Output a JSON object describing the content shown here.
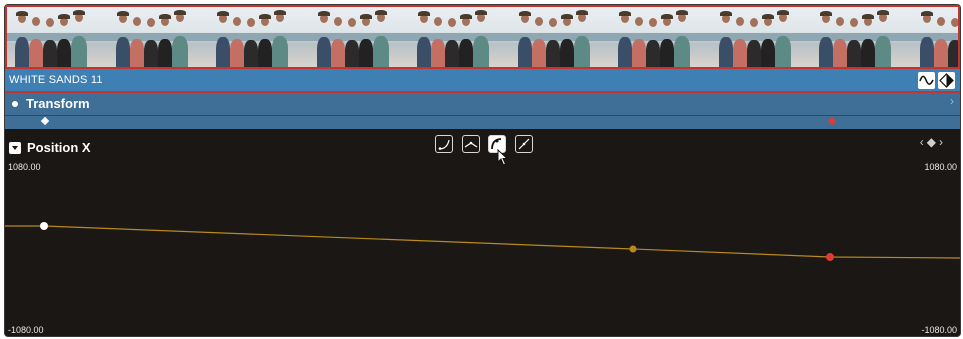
{
  "clip": {
    "name": "WHITE SANDS 11"
  },
  "transform": {
    "label": "Transform"
  },
  "parameter": {
    "label": "Position X"
  },
  "axis": {
    "top_left": "1080.00",
    "top_right": "1080.00",
    "bottom_left": "-1080.00",
    "bottom_right": "-1080.00"
  },
  "colors": {
    "clip_blue": "#3e7fb4",
    "selection_red": "#c3342f",
    "curve": "#b88a1c",
    "keyframe_selected": "#e03a36",
    "background": "#1b1714"
  },
  "icons": {
    "curve_toggle": "sine-wave-icon",
    "keyframe_toggle": "diamond-icon",
    "interpolation_tools": [
      "ease-in-icon",
      "linear-icon",
      "ease-out-icon",
      "bezier-icon"
    ],
    "selected_tool": "ease-out-icon"
  }
}
